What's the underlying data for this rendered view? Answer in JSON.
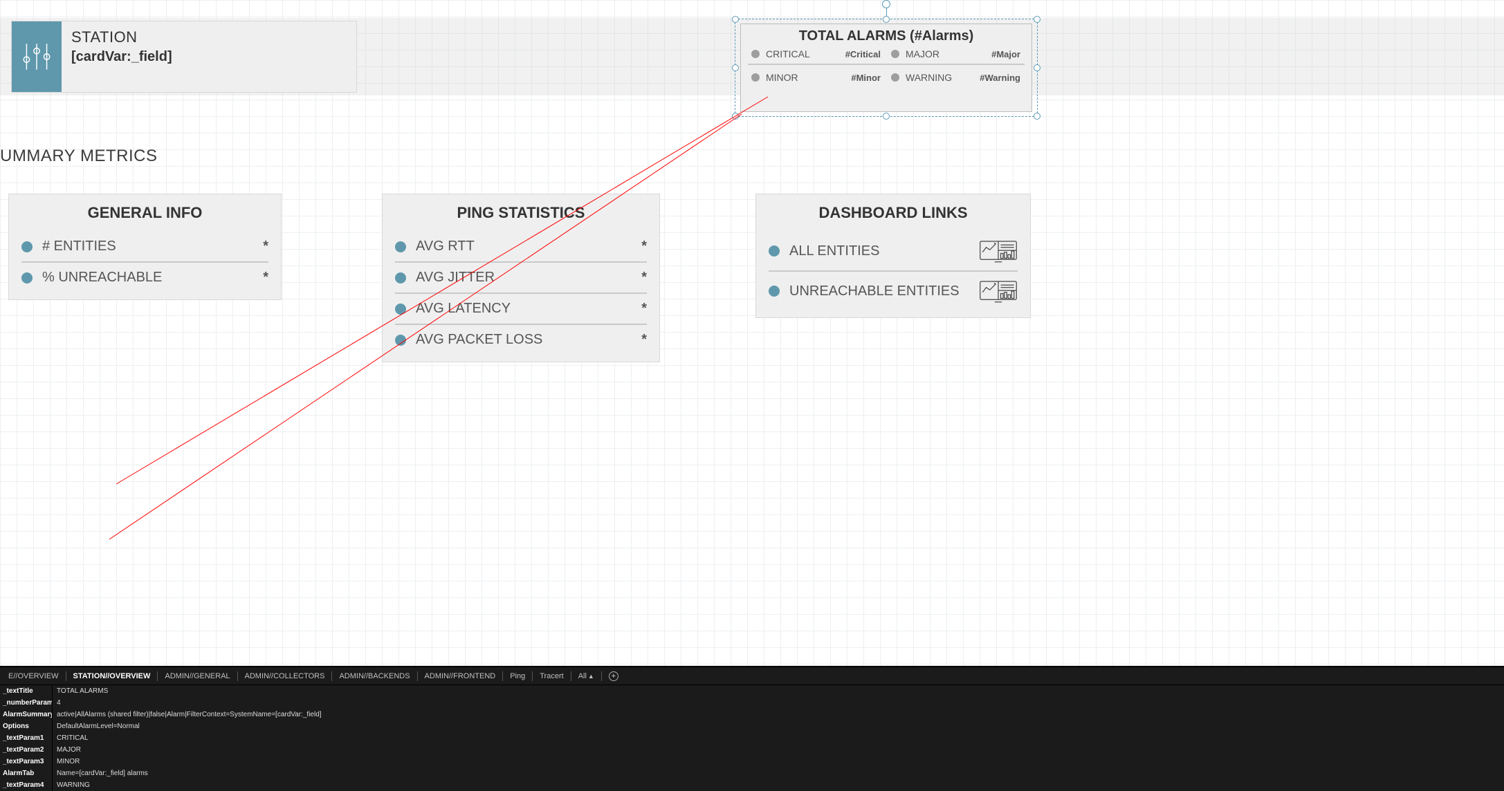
{
  "station": {
    "title": "STATION",
    "subtitle": "[cardVar:_field]"
  },
  "alarms": {
    "title": "TOTAL ALARMS (#Alarms)",
    "rows": [
      {
        "label": "CRITICAL",
        "value": "#Critical"
      },
      {
        "label": "MAJOR",
        "value": "#Major"
      },
      {
        "label": "MINOR",
        "value": "#Minor"
      },
      {
        "label": "WARNING",
        "value": "#Warning"
      }
    ]
  },
  "section_heading": "UMMARY METRICS",
  "panels": {
    "general": {
      "title": "GENERAL INFO",
      "metrics": [
        {
          "label": "# ENTITIES",
          "value": "*"
        },
        {
          "label": "% UNREACHABLE",
          "value": "*"
        }
      ]
    },
    "ping": {
      "title": "PING STATISTICS",
      "metrics": [
        {
          "label": "AVG RTT",
          "value": "*"
        },
        {
          "label": "AVG JITTER",
          "value": "*"
        },
        {
          "label": "AVG LATENCY",
          "value": "*"
        },
        {
          "label": "AVG PACKET LOSS",
          "value": "*"
        }
      ]
    },
    "dash": {
      "title": "DASHBOARD LINKS",
      "links": [
        {
          "label": "ALL ENTITIES"
        },
        {
          "label": "UNREACHABLE ENTITIES"
        }
      ]
    }
  },
  "tabs": [
    {
      "label": "E//OVERVIEW",
      "active": false
    },
    {
      "label": "STATION//OVERVIEW",
      "active": true
    },
    {
      "label": "ADMIN//GENERAL",
      "active": false
    },
    {
      "label": "ADMIN//COLLECTORS",
      "active": false
    },
    {
      "label": "ADMIN//BACKENDS",
      "active": false
    },
    {
      "label": "ADMIN//FRONTEND",
      "active": false
    },
    {
      "label": "Ping",
      "active": false
    },
    {
      "label": "Tracert",
      "active": false
    }
  ],
  "tab_all_label": "All",
  "tab_add_tooltip": "Add",
  "properties": [
    {
      "key": "_textTitle",
      "value": "TOTAL ALARMS"
    },
    {
      "key": "_numberParams",
      "value": "4"
    },
    {
      "key": "AlarmSummary",
      "value": "active|AllAlarms (shared filter)|false|Alarm|FilterContext=SystemName=[cardVar:_field]"
    },
    {
      "key": "Options",
      "value": "DefaultAlarmLevel=Normal"
    },
    {
      "key": "_textParam1",
      "value": "CRITICAL"
    },
    {
      "key": "_textParam2",
      "value": "MAJOR"
    },
    {
      "key": "_textParam3",
      "value": "MINOR"
    },
    {
      "key": "AlarmTab",
      "value": "Name=[cardVar:_field] alarms"
    },
    {
      "key": "_textParam4",
      "value": "WARNING"
    }
  ]
}
